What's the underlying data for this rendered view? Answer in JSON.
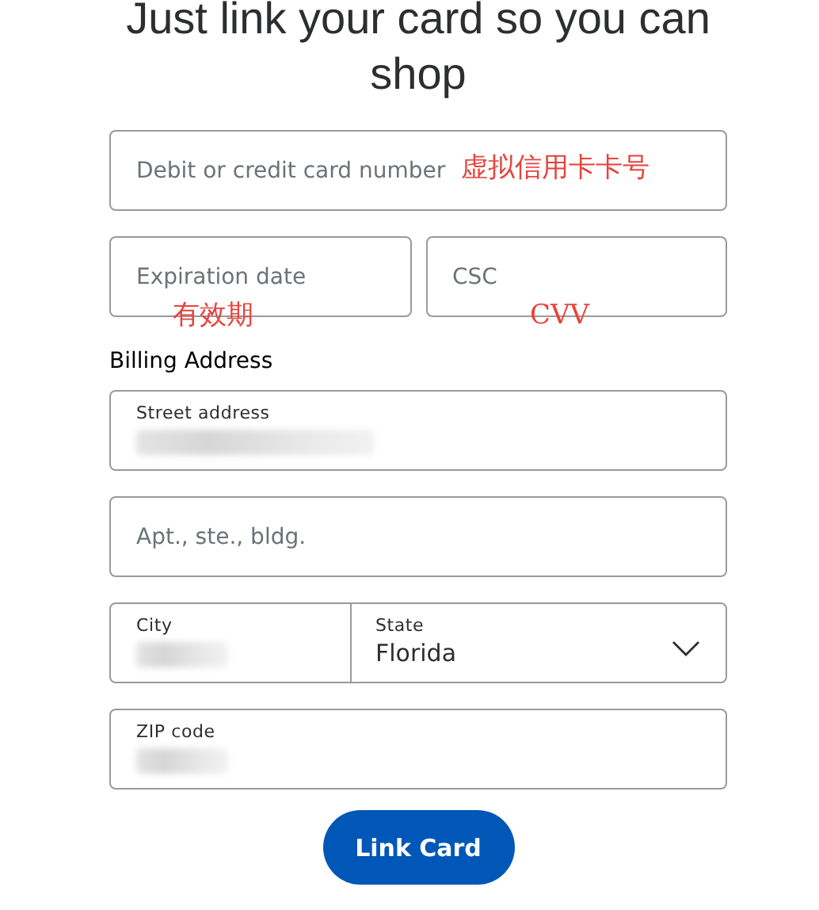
{
  "heading": "Just link your card so you can shop",
  "card_fields": [
    {
      "placeholder": "Debit or credit card number",
      "annotation": "虚拟信用卡卡号"
    },
    {
      "placeholder": "Expiration date",
      "annotation": "有效期"
    },
    {
      "placeholder": "CSC",
      "annotation": "CVV"
    }
  ],
  "billing_title": "Billing Address",
  "address_fields": [
    {
      "kind": "text",
      "label": "Street address"
    },
    {
      "kind": "text",
      "placeholder": "Apt., ste., bldg."
    },
    {
      "kind": "split",
      "label": "City",
      "select_label": "State",
      "select_value": "Florida"
    },
    {
      "kind": "text",
      "label": "ZIP code"
    }
  ],
  "button": "Link Card"
}
